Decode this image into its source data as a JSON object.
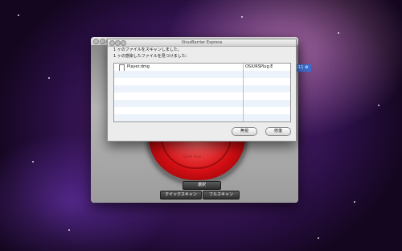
{
  "main_window": {
    "title": "VirusBarrier Express",
    "disc_label": "Quick Scan",
    "side_badge": "ル/11 ⚙",
    "select_label": "選択",
    "quick_scan_label": "クイックスキャン",
    "full_scan_label": "フルスキャン"
  },
  "dialog": {
    "message_line1": "1 ヶのファイルをスキャンしました。",
    "message_line2": "1 ヶの感染したファイルを見つけました：",
    "rows": [
      {
        "file": "Player.dmg",
        "threat": "OSX/RSPlug.E"
      }
    ],
    "ignore_label": "無視",
    "repair_label": "修復"
  },
  "colors": {
    "desktop": "#4b1f6e",
    "scan_button": "#d40f14",
    "badge": "#3a6fcf"
  }
}
